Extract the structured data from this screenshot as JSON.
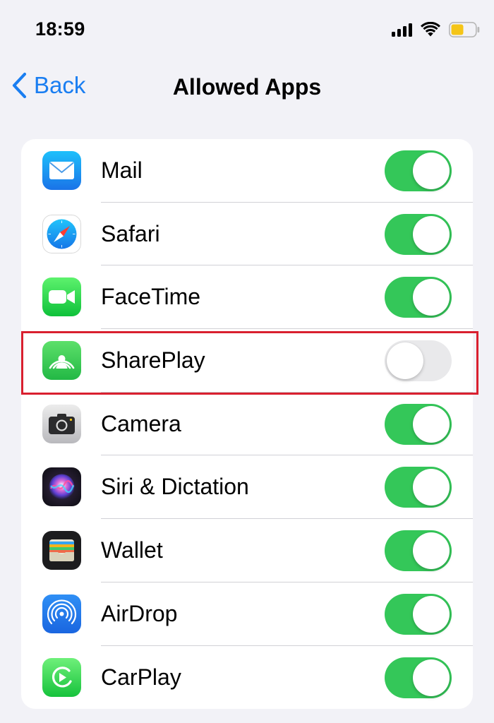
{
  "status_bar": {
    "time": "18:59"
  },
  "nav": {
    "back_label": "Back",
    "title": "Allowed Apps"
  },
  "apps": [
    {
      "label": "Mail",
      "icon": "mail-icon",
      "enabled": true
    },
    {
      "label": "Safari",
      "icon": "safari-icon",
      "enabled": true
    },
    {
      "label": "FaceTime",
      "icon": "facetime-icon",
      "enabled": true
    },
    {
      "label": "SharePlay",
      "icon": "shareplay-icon",
      "enabled": false,
      "highlighted": true
    },
    {
      "label": "Camera",
      "icon": "camera-icon",
      "enabled": true
    },
    {
      "label": "Siri & Dictation",
      "icon": "siri-icon",
      "enabled": true
    },
    {
      "label": "Wallet",
      "icon": "wallet-icon",
      "enabled": true
    },
    {
      "label": "AirDrop",
      "icon": "airdrop-icon",
      "enabled": true
    },
    {
      "label": "CarPlay",
      "icon": "carplay-icon",
      "enabled": true
    }
  ],
  "colors": {
    "toggle_on": "#34c759",
    "toggle_off": "#e9e9eb",
    "accent": "#1a7ef1",
    "highlight_border": "#d9202f"
  }
}
